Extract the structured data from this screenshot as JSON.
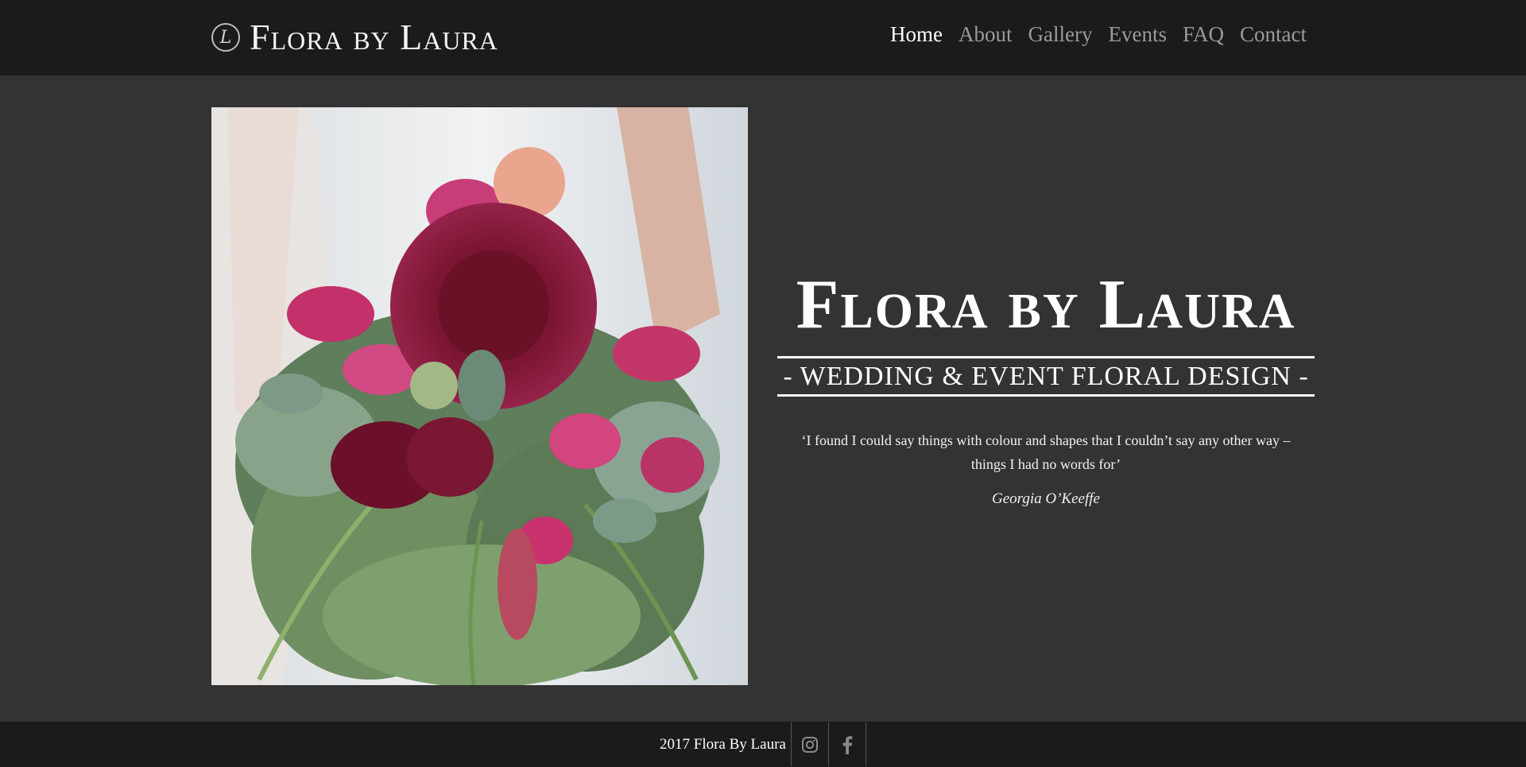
{
  "header": {
    "logo_letter": "L",
    "brand": "Flora by Laura",
    "nav": [
      {
        "label": "Home",
        "active": true
      },
      {
        "label": "About",
        "active": false
      },
      {
        "label": "Gallery",
        "active": false
      },
      {
        "label": "Events",
        "active": false
      },
      {
        "label": "FAQ",
        "active": false
      },
      {
        "label": "Contact",
        "active": false
      }
    ]
  },
  "hero": {
    "title": "Flora by Laura",
    "tagline": "- WEDDING & EVENT FLORAL DESIGN -",
    "quote": "‘I found I could say things with colour and shapes that I couldn’t say any other way – things I had no words for’",
    "author": "Georgia O’Keeffe"
  },
  "photo": {
    "subject": "bridal bouquet"
  },
  "footer": {
    "copyright": "2017 Flora By Laura",
    "social": [
      {
        "icon": "instagram-icon"
      },
      {
        "icon": "facebook-icon"
      }
    ]
  },
  "colors": {
    "page_bg": "#333333",
    "bar_bg": "#1c1b1c",
    "text": "#ffffff",
    "nav_inactive": "#9a9a9a"
  }
}
